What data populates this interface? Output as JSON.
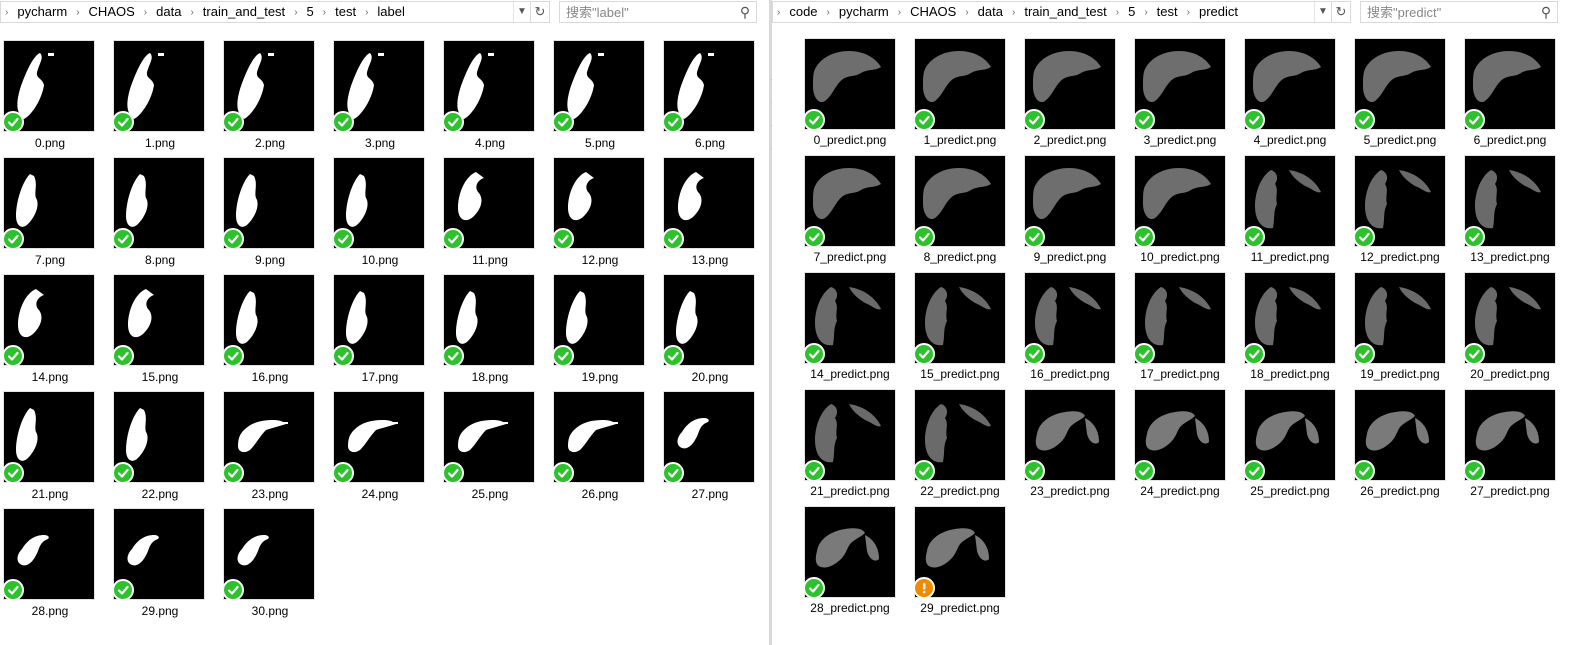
{
  "left": {
    "breadcrumb": [
      "pycharm",
      "CHAOS",
      "data",
      "train_and_test",
      "5",
      "test",
      "label"
    ],
    "search_placeholder": "搜索\"label\"",
    "files": [
      {
        "name": "0.png",
        "shape": "lbl-top",
        "status": "ok"
      },
      {
        "name": "1.png",
        "shape": "lbl-top",
        "status": "ok"
      },
      {
        "name": "2.png",
        "shape": "lbl-top",
        "status": "ok"
      },
      {
        "name": "3.png",
        "shape": "lbl-top",
        "status": "ok"
      },
      {
        "name": "4.png",
        "shape": "lbl-top",
        "status": "ok"
      },
      {
        "name": "5.png",
        "shape": "lbl-top",
        "status": "ok"
      },
      {
        "name": "6.png",
        "shape": "lbl-top",
        "status": "ok"
      },
      {
        "name": "7.png",
        "shape": "lbl-mid",
        "status": "ok"
      },
      {
        "name": "8.png",
        "shape": "lbl-mid",
        "status": "ok"
      },
      {
        "name": "9.png",
        "shape": "lbl-mid",
        "status": "ok"
      },
      {
        "name": "10.png",
        "shape": "lbl-mid",
        "status": "ok"
      },
      {
        "name": "11.png",
        "shape": "lbl-round",
        "status": "ok"
      },
      {
        "name": "12.png",
        "shape": "lbl-round",
        "status": "ok"
      },
      {
        "name": "13.png",
        "shape": "lbl-round",
        "status": "ok"
      },
      {
        "name": "14.png",
        "shape": "lbl-round",
        "status": "ok"
      },
      {
        "name": "15.png",
        "shape": "lbl-round",
        "status": "ok"
      },
      {
        "name": "16.png",
        "shape": "lbl-mid",
        "status": "ok"
      },
      {
        "name": "17.png",
        "shape": "lbl-mid",
        "status": "ok"
      },
      {
        "name": "18.png",
        "shape": "lbl-mid",
        "status": "ok"
      },
      {
        "name": "19.png",
        "shape": "lbl-mid",
        "status": "ok"
      },
      {
        "name": "20.png",
        "shape": "lbl-mid",
        "status": "ok"
      },
      {
        "name": "21.png",
        "shape": "lbl-mid",
        "status": "ok"
      },
      {
        "name": "22.png",
        "shape": "lbl-mid",
        "status": "ok"
      },
      {
        "name": "23.png",
        "shape": "lbl-wide",
        "status": "ok"
      },
      {
        "name": "24.png",
        "shape": "lbl-wide",
        "status": "ok"
      },
      {
        "name": "25.png",
        "shape": "lbl-wide",
        "status": "ok"
      },
      {
        "name": "26.png",
        "shape": "lbl-wide",
        "status": "ok"
      },
      {
        "name": "27.png",
        "shape": "lbl-wide2",
        "status": "ok"
      },
      {
        "name": "28.png",
        "shape": "lbl-wide2",
        "status": "ok"
      },
      {
        "name": "29.png",
        "shape": "lbl-wide2",
        "status": "ok"
      },
      {
        "name": "30.png",
        "shape": "lbl-wide2",
        "status": "ok"
      }
    ]
  },
  "right": {
    "breadcrumb": [
      "code",
      "pycharm",
      "CHAOS",
      "data",
      "train_and_test",
      "5",
      "test",
      "predict"
    ],
    "search_placeholder": "搜索\"predict\"",
    "files": [
      {
        "name": "0_predict.png",
        "shape": "pred-big",
        "status": "ok"
      },
      {
        "name": "1_predict.png",
        "shape": "pred-big",
        "status": "ok"
      },
      {
        "name": "2_predict.png",
        "shape": "pred-big",
        "status": "ok"
      },
      {
        "name": "3_predict.png",
        "shape": "pred-big",
        "status": "ok"
      },
      {
        "name": "4_predict.png",
        "shape": "pred-big",
        "status": "ok"
      },
      {
        "name": "5_predict.png",
        "shape": "pred-big",
        "status": "ok"
      },
      {
        "name": "6_predict.png",
        "shape": "pred-big",
        "status": "ok"
      },
      {
        "name": "7_predict.png",
        "shape": "pred-big",
        "status": "ok"
      },
      {
        "name": "8_predict.png",
        "shape": "pred-big",
        "status": "ok"
      },
      {
        "name": "9_predict.png",
        "shape": "pred-big",
        "status": "ok"
      },
      {
        "name": "10_predict.png",
        "shape": "pred-big",
        "status": "ok"
      },
      {
        "name": "11_predict.png",
        "shape": "pred-left",
        "status": "ok"
      },
      {
        "name": "12_predict.png",
        "shape": "pred-left",
        "status": "ok"
      },
      {
        "name": "13_predict.png",
        "shape": "pred-left",
        "status": "ok"
      },
      {
        "name": "14_predict.png",
        "shape": "pred-left",
        "status": "ok"
      },
      {
        "name": "15_predict.png",
        "shape": "pred-left",
        "status": "ok"
      },
      {
        "name": "16_predict.png",
        "shape": "pred-left",
        "status": "ok"
      },
      {
        "name": "17_predict.png",
        "shape": "pred-left",
        "status": "ok"
      },
      {
        "name": "18_predict.png",
        "shape": "pred-left",
        "status": "ok"
      },
      {
        "name": "19_predict.png",
        "shape": "pred-left",
        "status": "ok"
      },
      {
        "name": "20_predict.png",
        "shape": "pred-left",
        "status": "ok"
      },
      {
        "name": "21_predict.png",
        "shape": "pred-left",
        "status": "ok"
      },
      {
        "name": "22_predict.png",
        "shape": "pred-left",
        "status": "ok"
      },
      {
        "name": "23_predict.png",
        "shape": "pred-wide",
        "status": "ok"
      },
      {
        "name": "24_predict.png",
        "shape": "pred-wide",
        "status": "ok"
      },
      {
        "name": "25_predict.png",
        "shape": "pred-wide",
        "status": "ok"
      },
      {
        "name": "26_predict.png",
        "shape": "pred-wide",
        "status": "ok"
      },
      {
        "name": "27_predict.png",
        "shape": "pred-wide",
        "status": "ok"
      },
      {
        "name": "28_predict.png",
        "shape": "pred-wide",
        "status": "ok"
      },
      {
        "name": "29_predict.png",
        "shape": "pred-wide",
        "status": "sync-pending"
      }
    ]
  },
  "colors": {
    "ok_badge": "#2ec12e",
    "pending_badge": "#f08a00"
  },
  "icons": {
    "separator": "chevron-right-icon",
    "dropdown": "chevron-down-icon",
    "refresh": "refresh-icon",
    "search": "search-icon",
    "ok_badge": "sync-ok-icon",
    "pending_badge": "sync-pending-icon"
  }
}
